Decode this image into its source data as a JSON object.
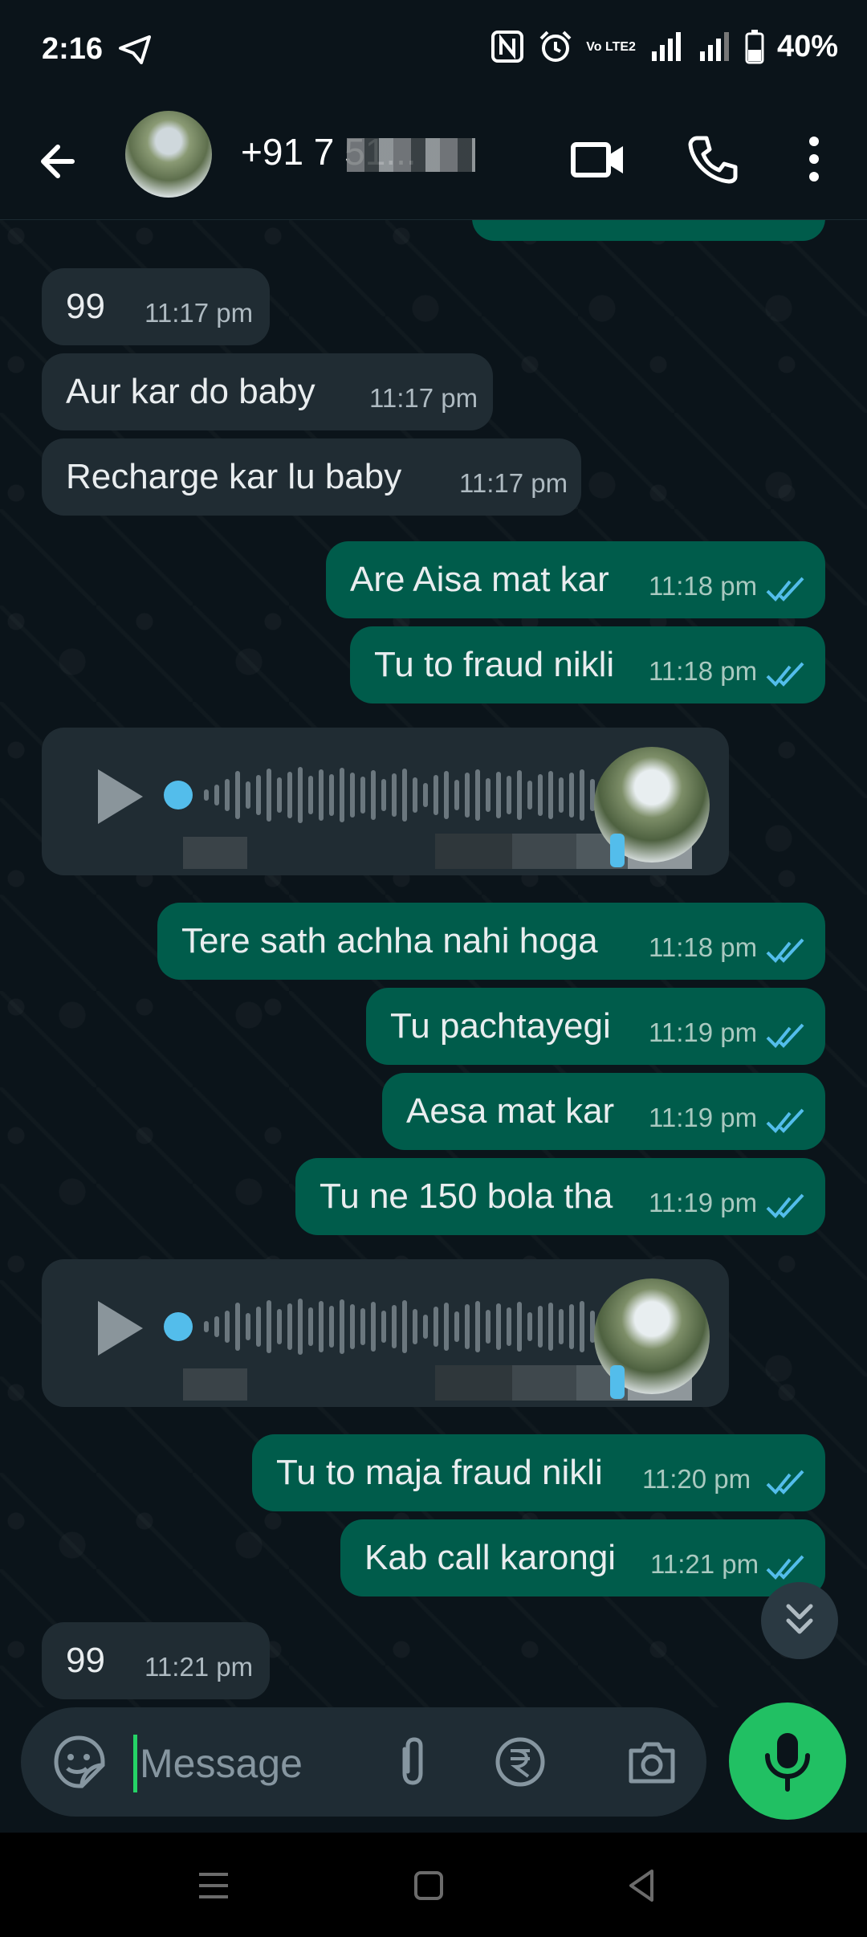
{
  "status_bar": {
    "time": "2:16",
    "battery": "40%",
    "network_label": "Vo LTE2"
  },
  "header": {
    "contact_name": "+91 7          51...",
    "icons": [
      "back-arrow-icon",
      "video-call-icon",
      "phone-icon",
      "more-options-icon"
    ]
  },
  "messages": [
    {
      "dir": "in",
      "text": "99",
      "time": "11:17 pm"
    },
    {
      "dir": "in",
      "text": "Aur kar do baby",
      "time": "11:17 pm"
    },
    {
      "dir": "in",
      "text": "Recharge kar lu baby",
      "time": "11:17 pm"
    },
    {
      "dir": "out",
      "text": "Are Aisa mat kar",
      "time": "11:18 pm"
    },
    {
      "dir": "out",
      "text": "Tu to fraud nikli",
      "time": "11:18 pm"
    },
    {
      "dir": "in",
      "type": "voice"
    },
    {
      "dir": "out",
      "text": "Tere sath achha nahi hoga",
      "time": "11:18 pm"
    },
    {
      "dir": "out",
      "text": "Tu pachtayegi",
      "time": "11:19 pm"
    },
    {
      "dir": "out",
      "text": "Aesa mat kar",
      "time": "11:19 pm"
    },
    {
      "dir": "out",
      "text": "Tu ne 150 bola tha",
      "time": "11:19 pm"
    },
    {
      "dir": "in",
      "type": "voice"
    },
    {
      "dir": "out",
      "text": "Tu to maja fraud nikli",
      "time": "11:20 pm"
    },
    {
      "dir": "out",
      "text": "Kab call karongi",
      "time": "11:21 pm"
    },
    {
      "dir": "in",
      "text": "99",
      "time": "11:21 pm"
    }
  ],
  "input": {
    "placeholder": "Message"
  },
  "colors": {
    "background": "#0b141a",
    "incoming_bubble": "#202c33",
    "outgoing_bubble": "#005c4b",
    "read_ticks": "#53bdeb",
    "accent": "#21c063"
  }
}
